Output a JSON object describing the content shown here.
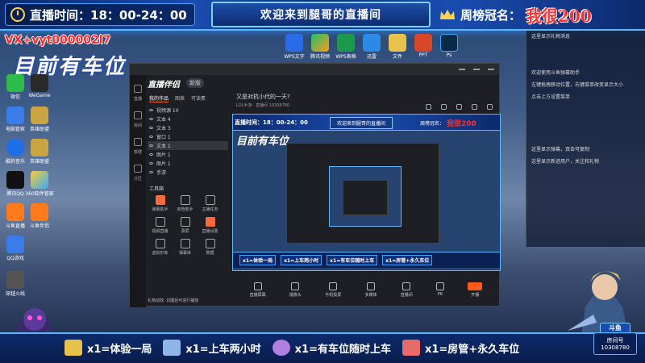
{
  "overlay": {
    "time_label": "直播时间：18：00-24：00",
    "welcome": "欢迎来到腿哥的直播间",
    "weekly_crown_label": "周榜冠名：",
    "weekly_crown_name": "我很200",
    "contact": "VX+vyt000002l7",
    "parking_status": "目前有车位"
  },
  "desktop_icons": [
    {
      "label": "微信"
    },
    {
      "label": "WeGame"
    },
    {
      "label": "电脑管家"
    },
    {
      "label": "英雄联盟"
    },
    {
      "label": "酷狗音乐"
    },
    {
      "label": "英雄联盟"
    },
    {
      "label": "腾讯QQ"
    },
    {
      "label": "360软件管家"
    },
    {
      "label": "斗鱼直播"
    },
    {
      "label": "斗鱼伴侣"
    },
    {
      "label": "QQ游戏"
    },
    {
      "label": "穿越火线"
    }
  ],
  "taskbar_icons": [
    {
      "label": "WPS文字"
    },
    {
      "label": "腾讯视频"
    },
    {
      "label": "WPS表格"
    },
    {
      "label": "迅雷"
    },
    {
      "label": "文件"
    },
    {
      "label": "PPT"
    },
    {
      "label": "Ps"
    }
  ],
  "app": {
    "logo": "直播伴侣",
    "version_tag": "新版",
    "rail": [
      "直播",
      "房间",
      "数据",
      "分区"
    ],
    "tabs": [
      {
        "label": "我的作品"
      },
      {
        "label": "图表"
      },
      {
        "label": "可读素"
      }
    ],
    "layers": [
      {
        "label": "视频源 10"
      },
      {
        "label": "文本 4"
      },
      {
        "label": "文本 3"
      },
      {
        "label": "窗口 1"
      },
      {
        "label": "文本 1"
      },
      {
        "label": "图片 1"
      },
      {
        "label": "图片 1"
      },
      {
        "label": "手游"
      }
    ],
    "tools_title": "工具箱",
    "tools": [
      {
        "label": "弹幕助手"
      },
      {
        "label": "房管助手"
      },
      {
        "label": "主播任务"
      },
      {
        "label": "视频直播"
      },
      {
        "label": "录屏"
      },
      {
        "label": "直播设置"
      },
      {
        "label": "虚拟形象"
      },
      {
        "label": "弹幕库"
      },
      {
        "label": "数据"
      }
    ],
    "stream_question": "又是对抗小代的一天?",
    "stream_meta": "LOL手游 · 直播间 10308780",
    "tip": "礼物动效: 识图后可进行播放",
    "footer": [
      {
        "label": "直播屏幕"
      },
      {
        "label": "摄像头"
      },
      {
        "label": "手机投屏"
      },
      {
        "label": "多媒体"
      },
      {
        "label": "直播间"
      },
      {
        "label": "PK"
      },
      {
        "label": "开播"
      }
    ]
  },
  "preview": {
    "time": "直播时间：18：00-24：00",
    "welcome": "欢迎来到腿哥的直播间",
    "crown_label": "周榜冠名：",
    "crown_name": "我很200",
    "parking": "目前有车位",
    "gifts": [
      "x1=体验一局",
      "x1=上车两小时",
      "x1=有车位随时上车",
      "x1=房管+永久车位"
    ]
  },
  "chat": [
    "这里显示礼物消息",
    "欢迎使用斗鱼弹幕助手",
    "左键拖拽移动位置，右键菜单改变显示大小",
    "点击上方设置菜单",
    "这里显示弹幕，双击可复制",
    "这里显示新进用户，关注和礼物"
  ],
  "gifts": [
    {
      "label": "x1=体验一局",
      "color": "#e8c14a"
    },
    {
      "label": "x1=上车两小时",
      "color": "#8fb6e8"
    },
    {
      "label": "x1=有车位随时上车",
      "color": "#b080e0"
    },
    {
      "label": "x1=房管+永久车位",
      "color": "#e86a6a"
    }
  ],
  "room": {
    "badge": "斗鱼",
    "label": "房间号",
    "number": "10308780"
  }
}
